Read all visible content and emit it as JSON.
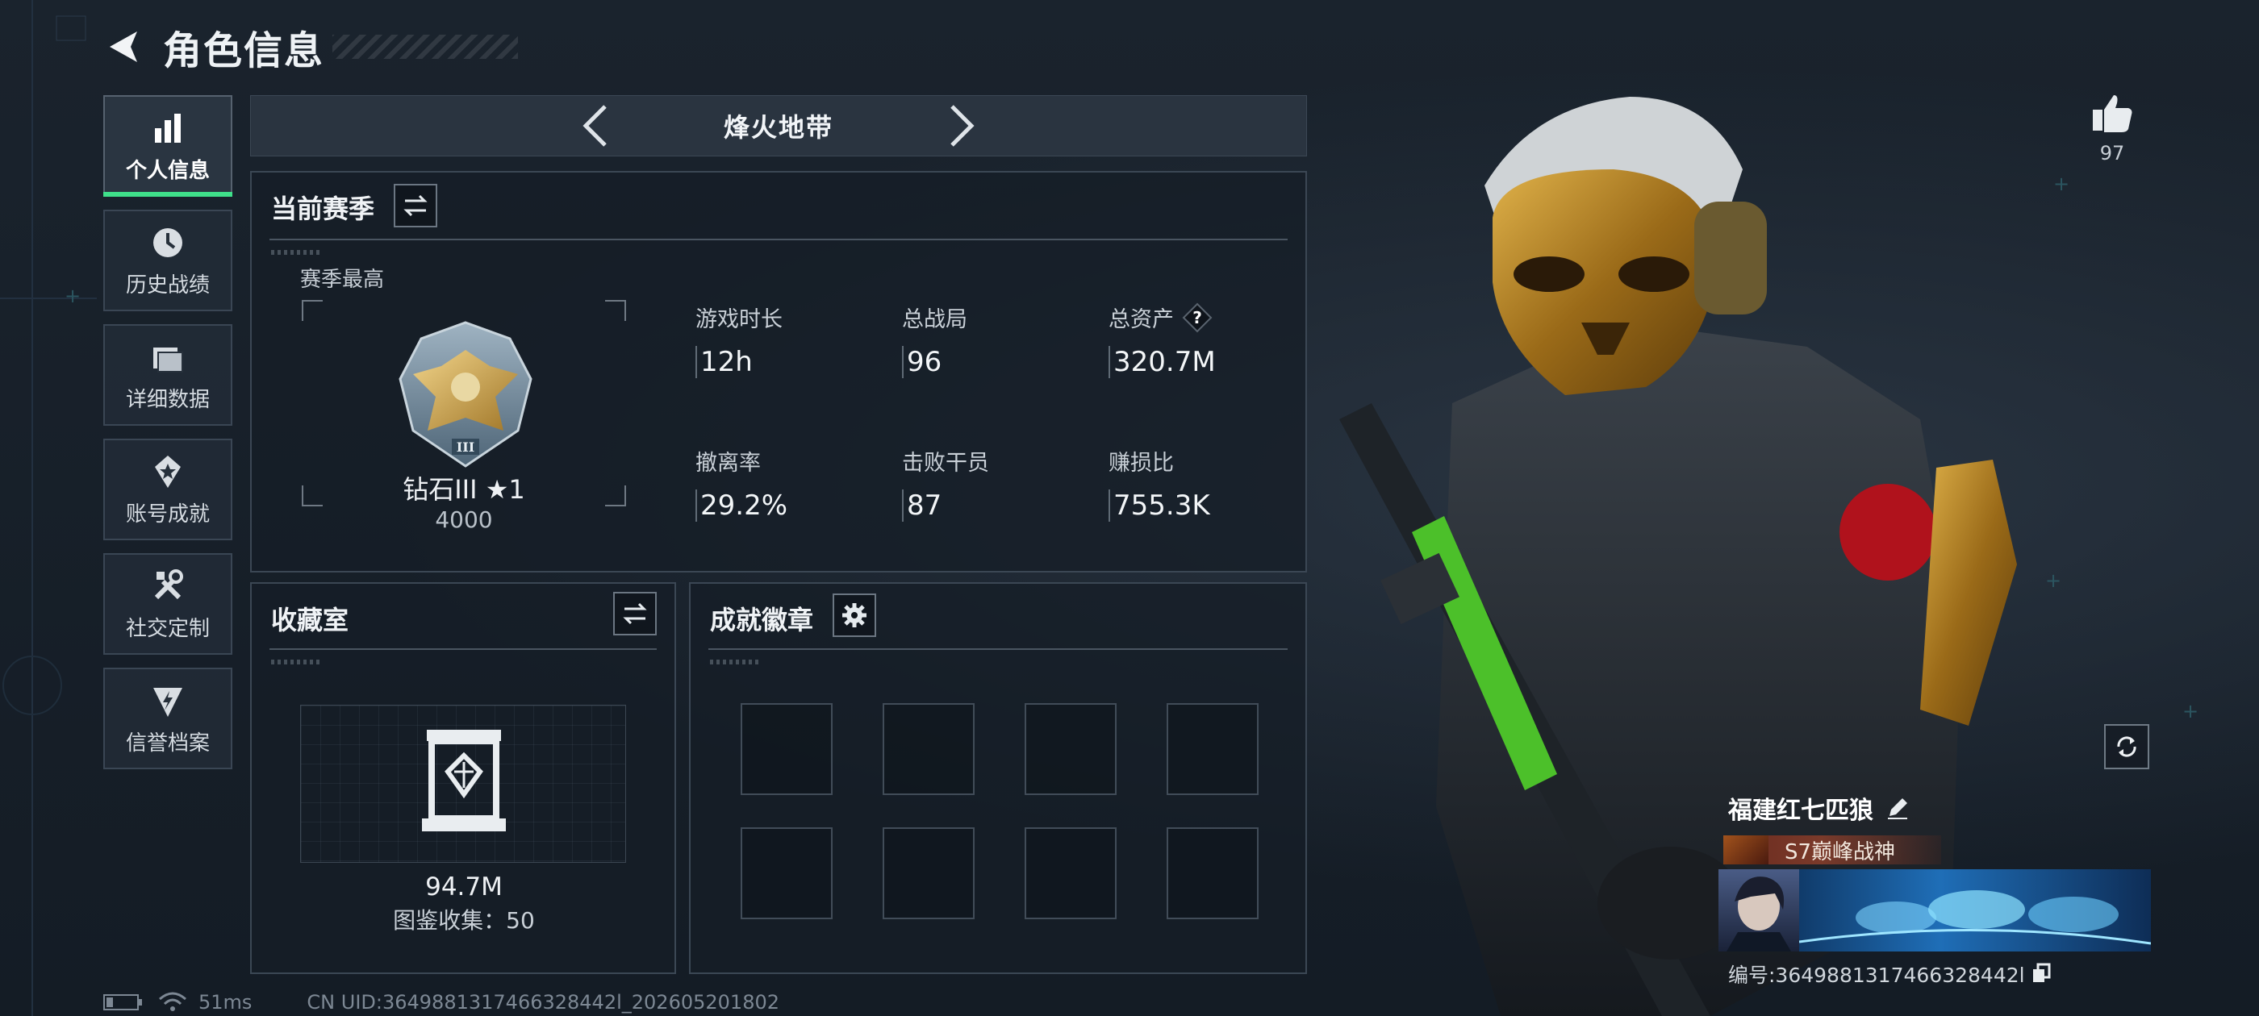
{
  "header": {
    "title": "角色信息"
  },
  "sidebar": {
    "items": [
      {
        "label": "个人信息",
        "icon": "bar-chart-icon",
        "active": true
      },
      {
        "label": "历史战绩",
        "icon": "history-clock-icon",
        "active": false
      },
      {
        "label": "详细数据",
        "icon": "folder-icon",
        "active": false
      },
      {
        "label": "账号成就",
        "icon": "achievement-star-icon",
        "active": false
      },
      {
        "label": "社交定制",
        "icon": "tools-icon",
        "active": false
      },
      {
        "label": "信誉档案",
        "icon": "shield-lightning-icon",
        "active": false
      }
    ]
  },
  "mode": {
    "title": "烽火地带"
  },
  "season": {
    "title": "当前赛季",
    "best_label": "赛季最高",
    "rank_name": "钻石III ★1",
    "rank_points": "4000",
    "stats": [
      {
        "label": "游戏时长",
        "value": "12h"
      },
      {
        "label": "总战局",
        "value": "96"
      },
      {
        "label": "总资产",
        "value": "320.7M",
        "help": true
      },
      {
        "label": "撤离率",
        "value": "29.2%"
      },
      {
        "label": "击败干员",
        "value": "87"
      },
      {
        "label": "赚损比",
        "value": "755.3K"
      }
    ]
  },
  "collection": {
    "title": "收藏室",
    "value": "94.7M",
    "sub": "图鉴收集：50"
  },
  "achievements": {
    "title": "成就徽章",
    "slots": 8
  },
  "status": {
    "latency": "51ms",
    "uid": "CN UID:3649881317466328442l_202605201802"
  },
  "player": {
    "likes": "97",
    "name": "福建红七匹狼",
    "title": "S7巅峰战神",
    "uid": "编号:3649881317466328442l"
  },
  "colors": {
    "accent": "#3fe08a",
    "panel_border": "#3b4754",
    "background": "#17202a"
  }
}
